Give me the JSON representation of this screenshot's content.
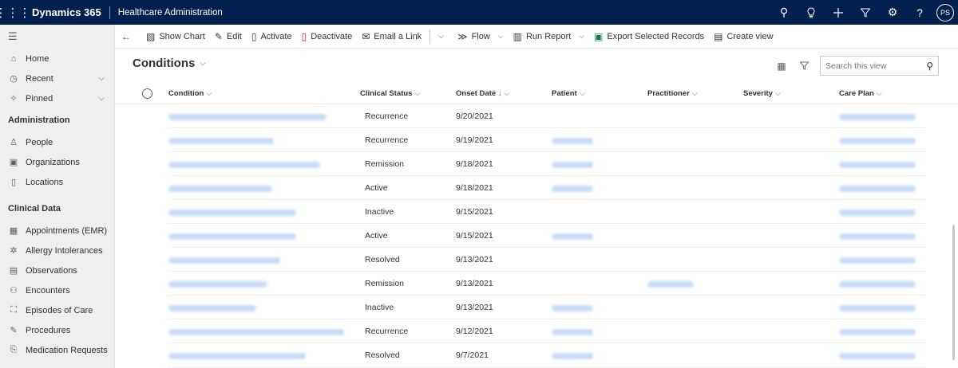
{
  "topbar": {
    "brand": "Dynamics 365",
    "app_name": "Healthcare Administration",
    "avatar_initials": "PS"
  },
  "nav": {
    "top_items": [
      {
        "label": "Home",
        "icon": "home-icon"
      },
      {
        "label": "Recent",
        "icon": "clock-icon",
        "expandable": true
      },
      {
        "label": "Pinned",
        "icon": "pin-icon",
        "expandable": true
      }
    ],
    "sections": [
      {
        "title": "Administration",
        "items": [
          {
            "label": "People",
            "icon": "person-icon"
          },
          {
            "label": "Organizations",
            "icon": "building-icon"
          },
          {
            "label": "Locations",
            "icon": "location-icon"
          }
        ]
      },
      {
        "title": "Clinical Data",
        "items": [
          {
            "label": "Appointments (EMR)",
            "icon": "calendar-icon"
          },
          {
            "label": "Allergy Intolerances",
            "icon": "allergy-icon"
          },
          {
            "label": "Observations",
            "icon": "observation-icon"
          },
          {
            "label": "Encounters",
            "icon": "encounter-icon"
          },
          {
            "label": "Episodes of Care",
            "icon": "episode-icon"
          },
          {
            "label": "Procedures",
            "icon": "procedure-icon"
          },
          {
            "label": "Medication Requests",
            "icon": "medication-icon"
          }
        ]
      }
    ]
  },
  "commands": {
    "show_chart": "Show Chart",
    "edit": "Edit",
    "activate": "Activate",
    "deactivate": "Deactivate",
    "email_link": "Email a Link",
    "flow": "Flow",
    "run_report": "Run Report",
    "export": "Export Selected Records",
    "create_view": "Create view"
  },
  "view": {
    "title": "Conditions",
    "search_placeholder": "Search this view"
  },
  "grid": {
    "columns": [
      "Condition",
      "Clinical Status",
      "Onset Date",
      "Patient",
      "Practitioner",
      "Severity",
      "Care Plan"
    ],
    "sorted_column": "Onset Date",
    "rows": [
      {
        "status": "Recurrence",
        "onset": "9/20/2021",
        "patient": false,
        "practitioner": false
      },
      {
        "status": "Recurrence",
        "onset": "9/19/2021",
        "patient": true,
        "practitioner": false
      },
      {
        "status": "Remission",
        "onset": "9/18/2021",
        "patient": true,
        "practitioner": false
      },
      {
        "status": "Active",
        "onset": "9/18/2021",
        "patient": true,
        "practitioner": false
      },
      {
        "status": "Inactive",
        "onset": "9/15/2021",
        "patient": false,
        "practitioner": false
      },
      {
        "status": "Active",
        "onset": "9/15/2021",
        "patient": true,
        "practitioner": false
      },
      {
        "status": "Resolved",
        "onset": "9/13/2021",
        "patient": false,
        "practitioner": false
      },
      {
        "status": "Remission",
        "onset": "9/13/2021",
        "patient": false,
        "practitioner": true
      },
      {
        "status": "Inactive",
        "onset": "9/13/2021",
        "patient": true,
        "practitioner": false
      },
      {
        "status": "Recurrence",
        "onset": "9/12/2021",
        "patient": true,
        "practitioner": false
      },
      {
        "status": "Resolved",
        "onset": "9/7/2021",
        "patient": true,
        "practitioner": false
      }
    ]
  },
  "colors": {
    "topbar": "#002050",
    "link_blur": "#c7dcf5",
    "excel_green": "#107c41"
  }
}
